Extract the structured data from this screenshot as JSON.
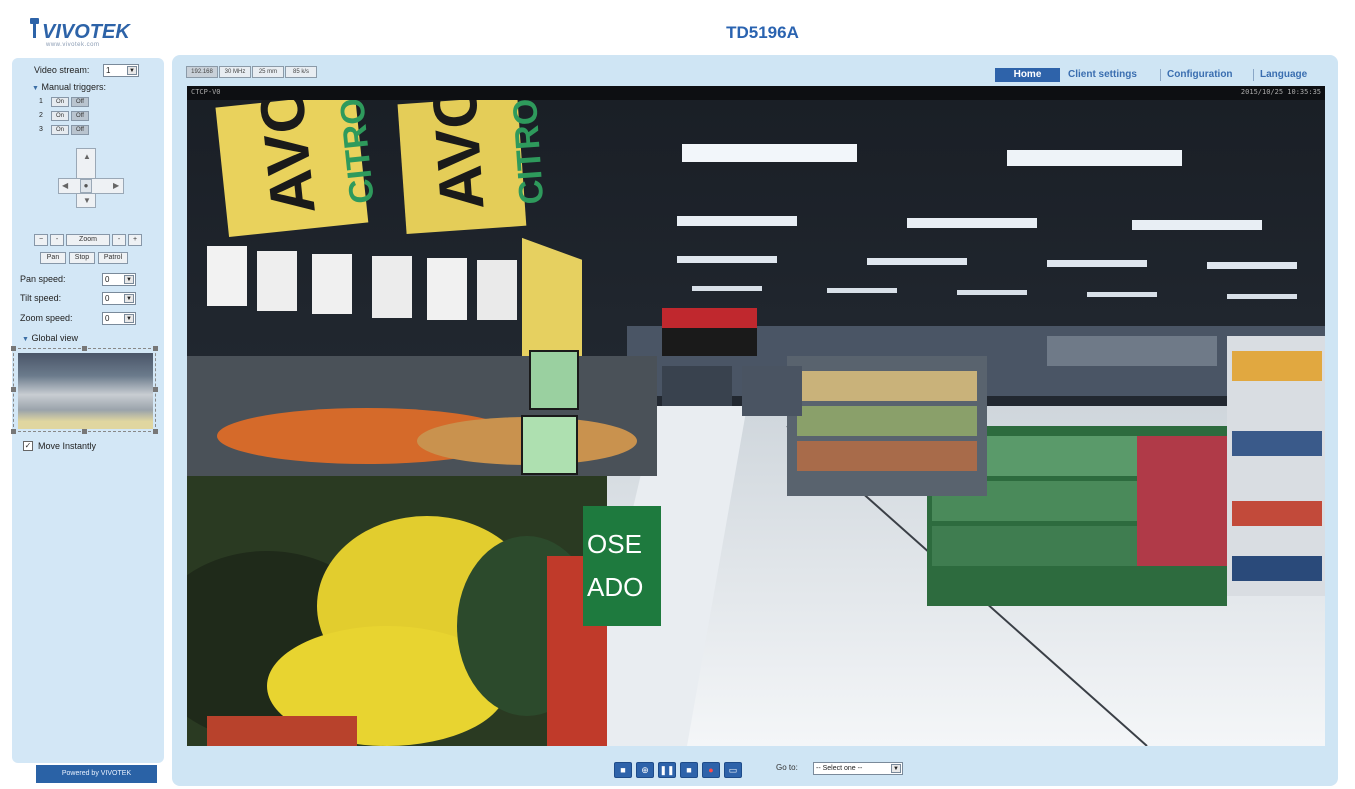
{
  "app": {
    "title": "TD5196A",
    "logo_text": "VIVOTEK",
    "logo_tagline": "www.vivotek.com",
    "powered_by": "Powered by VIVOTEK"
  },
  "colors": {
    "brand_blue": "#2a63b0",
    "nav_active_bg": "#2e63aa",
    "panel_bg": "#d3e7f6",
    "frame_bg": "#cfe5f4"
  },
  "sidebar": {
    "video_stream_label": "Video stream:",
    "video_stream_value": "1",
    "manual_triggers_label": "Manual triggers:",
    "triggers": [
      {
        "index": "1",
        "on": "On",
        "off": "Off"
      },
      {
        "index": "2",
        "on": "On",
        "off": "Off"
      },
      {
        "index": "3",
        "on": "On",
        "off": "Off"
      }
    ],
    "zoom_label": "Zoom",
    "zoom_out": "−",
    "zoom_in": "+",
    "pan_btn": "Pan",
    "stop_btn": "Stop",
    "patrol_btn": "Patrol",
    "pan_speed_label": "Pan speed:",
    "pan_speed_value": "0",
    "tilt_speed_label": "Tilt speed:",
    "tilt_speed_value": "0",
    "zoom_speed_label": "Zoom speed:",
    "zoom_speed_value": "0",
    "global_view_label": "Global view",
    "move_instantly_label": "Move Instantly",
    "move_instantly_checked": true
  },
  "stream_tabs": [
    "192.168",
    "30 MHz",
    "25 mm",
    "85 k/s"
  ],
  "nav": {
    "home": "Home",
    "client_settings": "Client settings",
    "configuration": "Configuration",
    "language": "Language"
  },
  "video": {
    "caption_left": "CTCP-V0",
    "caption_right": "2015/10/25 10:35:35"
  },
  "toolbar": {
    "snapshot_icon": "camera-icon",
    "zoom_icon": "magnify-icon",
    "pause_icon": "pause-icon",
    "stop_icon": "stop-icon",
    "record_icon": "record-icon",
    "fullscreen_icon": "fullscreen-icon",
    "goto_label": "Go to:",
    "goto_value": "-- Select one --"
  }
}
